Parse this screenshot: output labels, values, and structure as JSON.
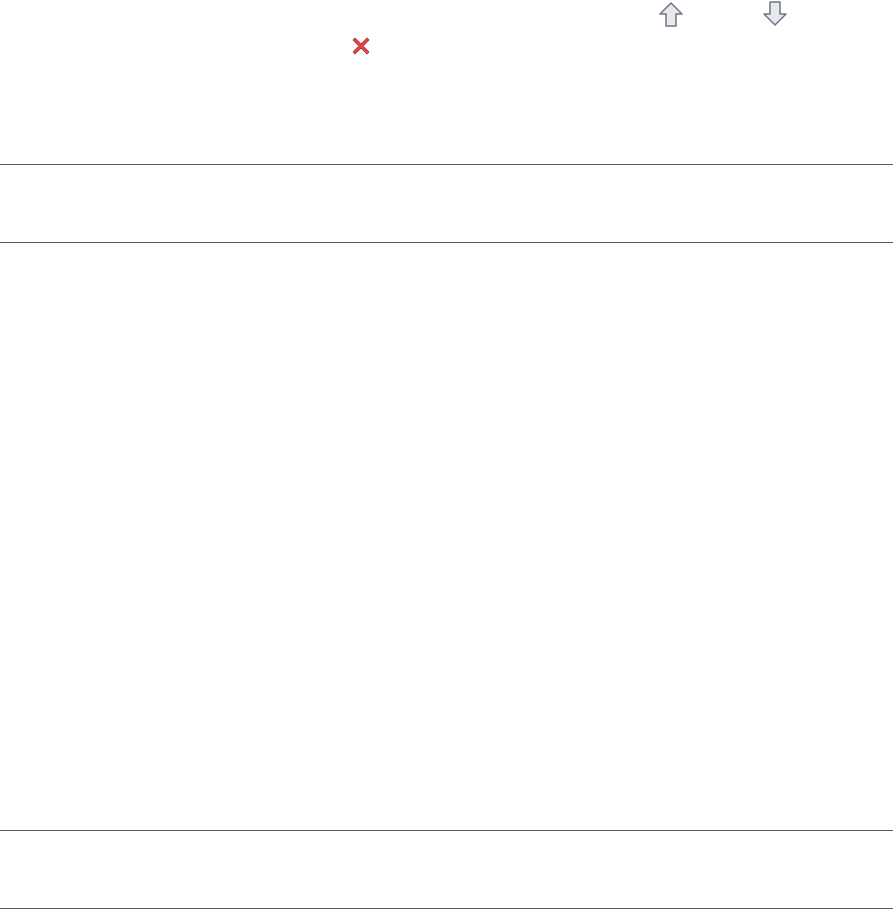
{
  "toolbar": {
    "move_up_icon": "arrow-up-outline-icon",
    "move_down_icon": "arrow-down-outline-icon",
    "delete_icon": "red-x-icon"
  },
  "colors": {
    "background": "#ffffff",
    "divider": "#5a5a5a",
    "arrow_fill": "#e6e9ee",
    "arrow_stroke": "#6f7680",
    "delete_red": "#e14848"
  }
}
